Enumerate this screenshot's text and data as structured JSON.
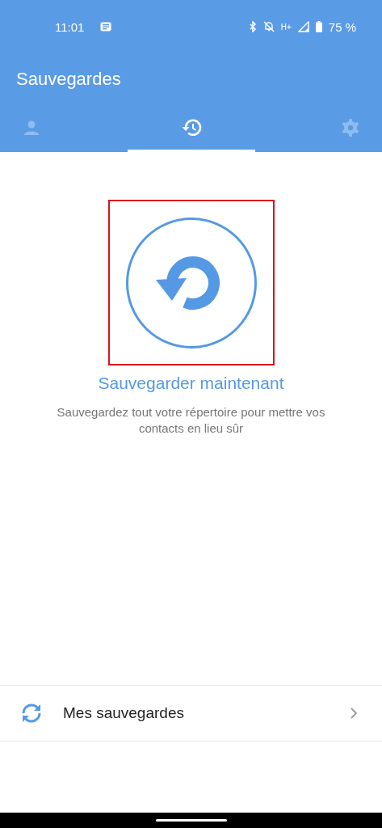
{
  "status_bar": {
    "time": "11:01",
    "network": "H+",
    "battery": "75 %"
  },
  "app_bar": {
    "title": "Sauvegardes"
  },
  "tabs": [
    {
      "kind": "person",
      "selected": false
    },
    {
      "kind": "history",
      "selected": true
    },
    {
      "kind": "settings",
      "selected": false
    }
  ],
  "backup": {
    "highlighted": true,
    "title": "Sauvegarder maintenant",
    "description": "Sauvegardez tout votre répertoire pour mettre vos contacts en lieu sûr"
  },
  "list": [
    {
      "label": "Mes sauvegardes"
    }
  ]
}
